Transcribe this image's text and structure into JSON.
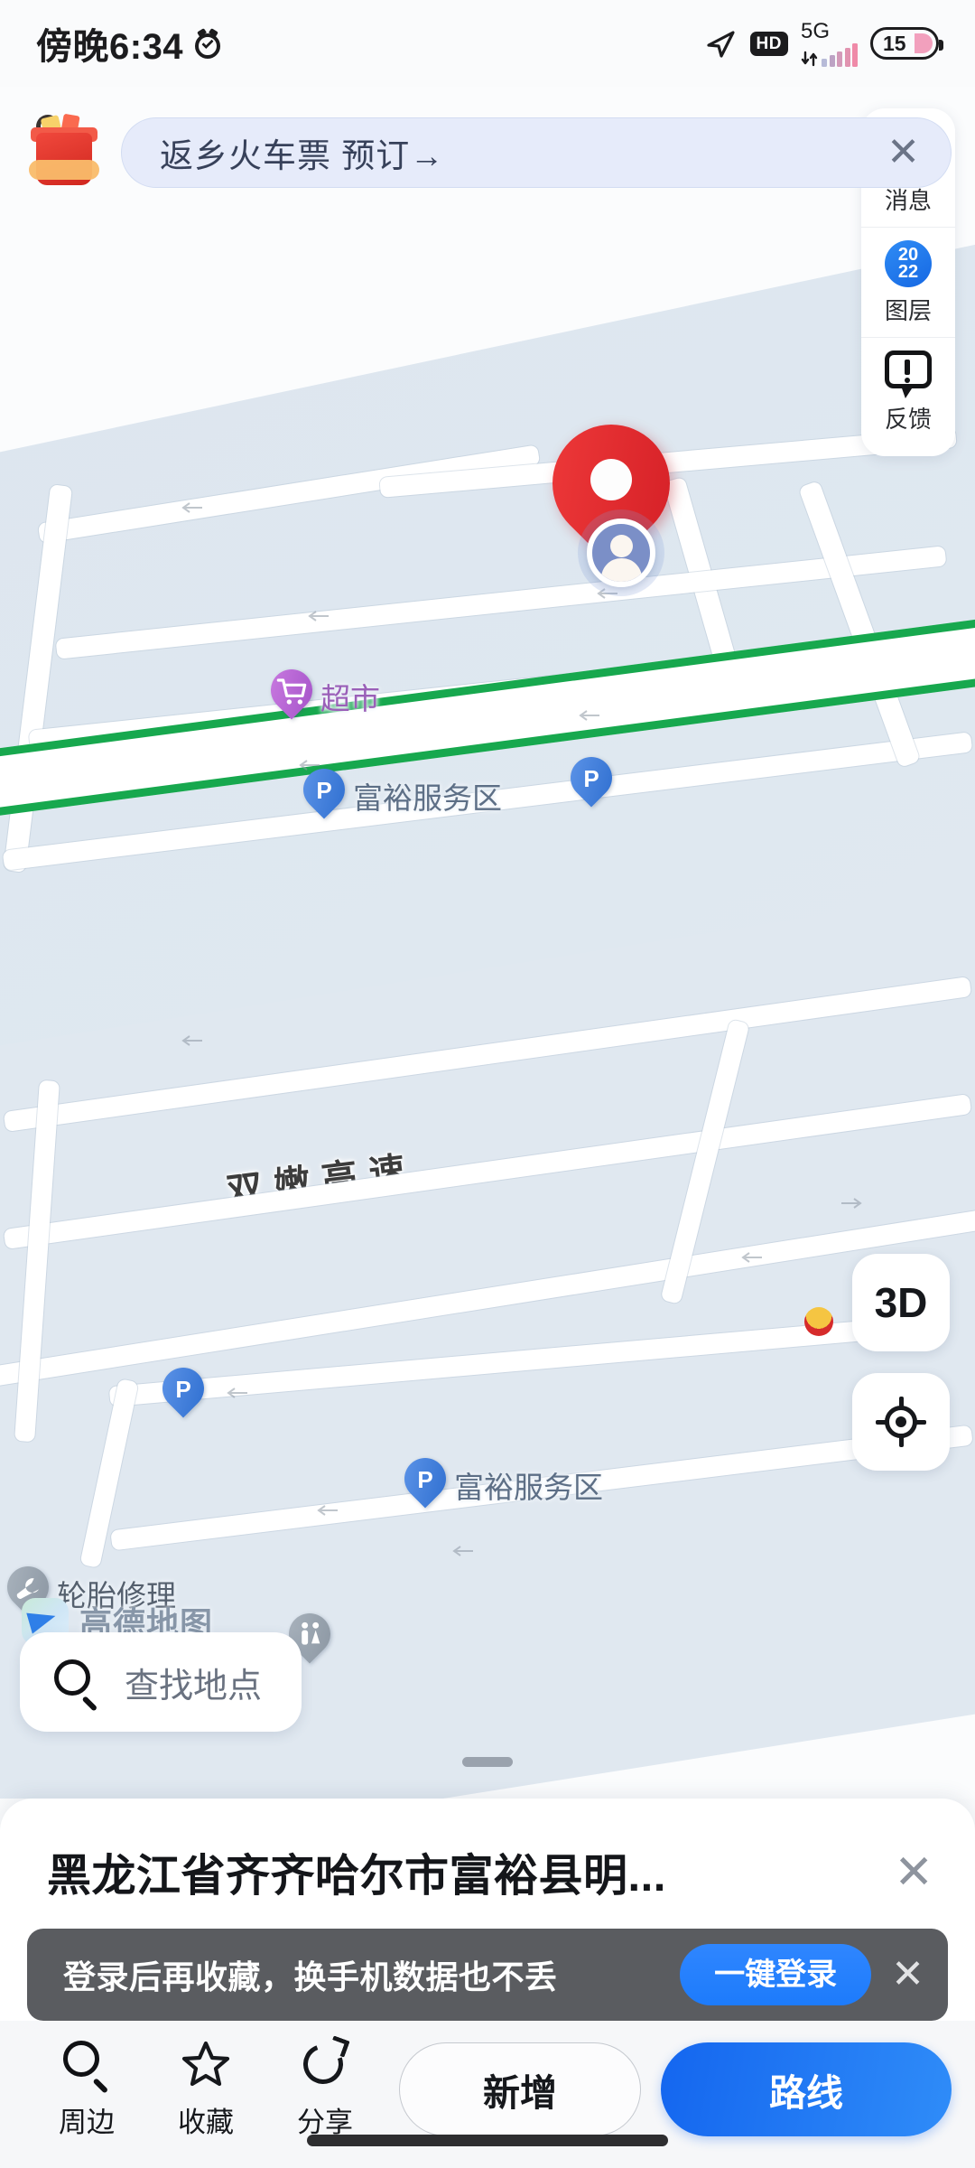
{
  "status_bar": {
    "time": "傍晚6:34",
    "alarm_icon": "alarm-clock-icon",
    "location_icon": "navigation-arrow-icon",
    "hd_badge": "HD",
    "network_type": "5G",
    "battery_level": "15"
  },
  "ad_banner": {
    "icon": "gift-box-icon",
    "text": "返乡火车票 预订→",
    "close_icon": "✕"
  },
  "tools": [
    {
      "label": "消息",
      "icon": "message-bubble-icon"
    },
    {
      "label": "图层",
      "icon": "layers-2022-badge-icon",
      "badge_top": "20",
      "badge_bottom": "22"
    },
    {
      "label": "反馈",
      "icon": "feedback-exclamation-icon"
    }
  ],
  "map": {
    "highway_label": "双嫩高速",
    "highway_color": "#17a84e",
    "land_color": "#dfe8f0",
    "road_color": "#ffffff",
    "selected_pin_color": "#e02a32",
    "pois": [
      {
        "name": "超市",
        "icon": "shopping-cart-pin",
        "color": "#b463d2",
        "glyph": "🛒"
      },
      {
        "name": "富裕服务区",
        "icon": "parking-pin",
        "color": "#3f7fdc",
        "glyph": "P"
      },
      {
        "name": "",
        "icon": "parking-pin",
        "color": "#3f7fdc",
        "glyph": "P"
      },
      {
        "name": "",
        "icon": "parking-pin",
        "color": "#3f7fdc",
        "glyph": "P"
      },
      {
        "name": "富裕服务区",
        "icon": "parking-pin",
        "color": "#3f7fdc",
        "glyph": "P"
      },
      {
        "name": "轮胎修理",
        "icon": "wrench-pin",
        "color": "#9aa5b0",
        "glyph": "🔧"
      },
      {
        "name": "",
        "icon": "restroom-pin",
        "color": "#9aa5b0",
        "glyph": "🚻"
      },
      {
        "name": "",
        "icon": "gas-station-pin",
        "color": "#d62b2b",
        "glyph": ""
      }
    ],
    "attribution": "高德地图",
    "controls": {
      "view_3d": "3D",
      "locate_icon": "crosshair-locate-icon"
    }
  },
  "search": {
    "placeholder": "查找地点",
    "icon": "search-icon"
  },
  "sheet": {
    "title": "黑龙江省齐齐哈尔市富裕县明...",
    "close_icon": "✕"
  },
  "toast": {
    "message": "登录后再收藏，换手机数据也不丢",
    "button": "一键登录",
    "close_icon": "✕"
  },
  "action_bar": {
    "items": [
      {
        "label": "周边",
        "icon": "search-icon"
      },
      {
        "label": "收藏",
        "icon": "star-icon"
      },
      {
        "label": "分享",
        "icon": "share-icon"
      }
    ],
    "secondary_button": "新增",
    "primary_button": "路线",
    "primary_color": "#1d7bfb"
  }
}
